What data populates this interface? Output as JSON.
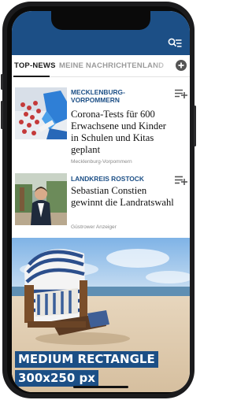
{
  "tabs": [
    {
      "label": "TOP-NEWS"
    },
    {
      "label": "MEINE NACHRICHTEN"
    },
    {
      "label": "LAND"
    }
  ],
  "articles": [
    {
      "kicker_lines": [
        "MECKLENBURG-",
        "VORPOMMERN"
      ],
      "headline": "Corona-Tests für 600 Erwachsene und Kinder in Schulen und Kitas geplant",
      "source": "Mecklenburg-Vorpommern"
    },
    {
      "kicker": "LANDKREIS ROSTOCK",
      "headline": "Sebastian Constien gewinnt die Landratswahl",
      "source": "Güstrower Anzeiger"
    }
  ],
  "ad": {
    "label_line1": "MEDIUM RECTANGLE",
    "label_line2": "300x250 px"
  },
  "icons": {
    "menu": "search-menu-icon",
    "add_tab": "plus-icon",
    "bookmark": "playlist-add-icon"
  },
  "colors": {
    "brand_blue": "#1c4f86",
    "text_dark": "#111111",
    "text_muted": "#8a8a8a"
  }
}
